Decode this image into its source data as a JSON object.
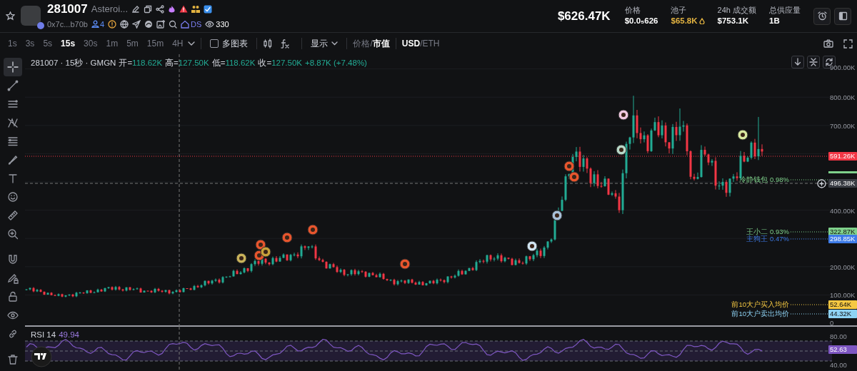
{
  "token": {
    "symbol": "281007",
    "name": "Asteroi...",
    "address": "0x7c...b70b",
    "holders_badge": "4",
    "dex_label": "DS",
    "watchers": "330"
  },
  "market": {
    "market_cap": "$626.47K",
    "stats": [
      {
        "label": "价格",
        "value": "$0.0₅626",
        "kind": "plain"
      },
      {
        "label": "池子",
        "value": "$65.8K",
        "kind": "pool"
      },
      {
        "label": "24h 成交额",
        "value": "$753.1K",
        "kind": "plain"
      },
      {
        "label": "总供应量",
        "value": "1B",
        "kind": "plain"
      }
    ]
  },
  "intervals": [
    {
      "label": "1s",
      "selected": false
    },
    {
      "label": "3s",
      "selected": false
    },
    {
      "label": "5s",
      "selected": false
    },
    {
      "label": "15s",
      "selected": true
    },
    {
      "label": "30s",
      "selected": false
    },
    {
      "label": "1m",
      "selected": false
    },
    {
      "label": "5m",
      "selected": false
    },
    {
      "label": "15m",
      "selected": false
    },
    {
      "label": "4H",
      "selected": false
    }
  ],
  "multi_chart": {
    "label": "多图表",
    "checked": false
  },
  "display_menu": {
    "label": "显示"
  },
  "price_mode": {
    "separator": "/",
    "options": [
      {
        "label": "价格",
        "selected": false
      },
      {
        "label": "市值",
        "selected": true
      }
    ]
  },
  "currency": {
    "separator": "/",
    "options": [
      {
        "label": "USD",
        "selected": true
      },
      {
        "label": "ETH",
        "selected": false
      }
    ]
  },
  "drawing_tools": [
    {
      "selected": true
    },
    {
      "selected": false
    },
    {
      "selected": false
    },
    {
      "selected": false
    },
    {
      "selected": false
    },
    {
      "selected": false
    },
    {
      "selected": false
    },
    {
      "selected": false
    },
    {
      "selected": false
    },
    {
      "selected": false
    },
    {
      "selected": false
    },
    {
      "selected": false
    },
    {
      "selected": false
    },
    {
      "selected": false
    },
    {
      "selected": false
    },
    {
      "selected": false
    }
  ],
  "legend": {
    "title": "281007 · 15秒 · GMGN",
    "ohlc": [
      {
        "label": "开=",
        "value": "118.62K"
      },
      {
        "label": "高=",
        "value": "127.50K"
      },
      {
        "label": "低=",
        "value": "118.62K"
      },
      {
        "label": "收=",
        "value": "127.50K"
      }
    ],
    "change": "+8.87K (+7.48%)"
  },
  "price_axis": [
    "900.00K",
    "800.00K",
    "700.00K",
    "400.00K",
    "200.00K",
    "100.00K",
    "0"
  ],
  "last_price": {
    "tag": "591.26K",
    "color": "#f23645"
  },
  "crosshair_price": "496.38K",
  "price_lines": [
    {
      "label": "冷静钱包 0.98%",
      "color": "#7fd18b"
    },
    {
      "label": "王小二 0.93%",
      "tag": "322.87K",
      "color": "#7fd18b"
    },
    {
      "label": "主狗王 0.47%",
      "tag": "298.85K",
      "color": "#3d7be8"
    },
    {
      "label": "前10大户买入均价",
      "tag": "52.64K",
      "color": "#f5c842"
    },
    {
      "label": "前10大户卖出均价",
      "tag": "44.32K",
      "color": "#8fd3f4"
    }
  ],
  "rsi": {
    "label": "RSI 14",
    "value": "49.94",
    "axis": [
      "80.00",
      "40.00"
    ],
    "tag": "52.63"
  }
}
